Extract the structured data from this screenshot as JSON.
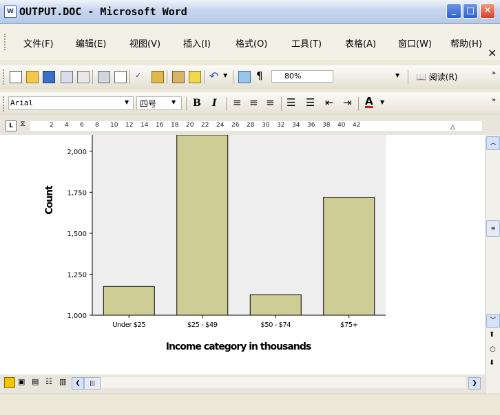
{
  "window": {
    "title": "OUTPUT.DOC - Microsoft Word",
    "icon": "word-doc-icon"
  },
  "menubar": {
    "items": [
      "文件(F)",
      "编辑(E)",
      "视图(V)",
      "插入(I)",
      "格式(O)",
      "工具(T)",
      "表格(A)",
      "窗口(W)",
      "帮助(H)"
    ],
    "close_glyph": "×"
  },
  "toolbar": {
    "zoom_value": "80%",
    "read_label": "阅读(R)"
  },
  "format_bar": {
    "font": "Arial",
    "size": "四号",
    "bold": "B",
    "italic": "I",
    "font_color": "A"
  },
  "ruler": {
    "ticks": [
      "2",
      "4",
      "6",
      "8",
      "10",
      "12",
      "14",
      "16",
      "18",
      "20",
      "22",
      "24",
      "26",
      "28",
      "30",
      "32",
      "34",
      "36",
      "38",
      "40",
      "42"
    ]
  },
  "chart_data": {
    "type": "bar",
    "categories": [
      "Under $25",
      "$25 - $49",
      "$50 - $74",
      "$75+"
    ],
    "values": [
      1175,
      2100,
      1125,
      1720
    ],
    "xlabel": "Income category in thousands",
    "ylabel": "Count",
    "ylim": [
      1000,
      2100
    ],
    "yticks": [
      "1,000",
      "1,250",
      "1,500",
      "1,750",
      "2,000"
    ],
    "bar_color": "#cecd96",
    "plot_bg": "#eeeeee"
  }
}
